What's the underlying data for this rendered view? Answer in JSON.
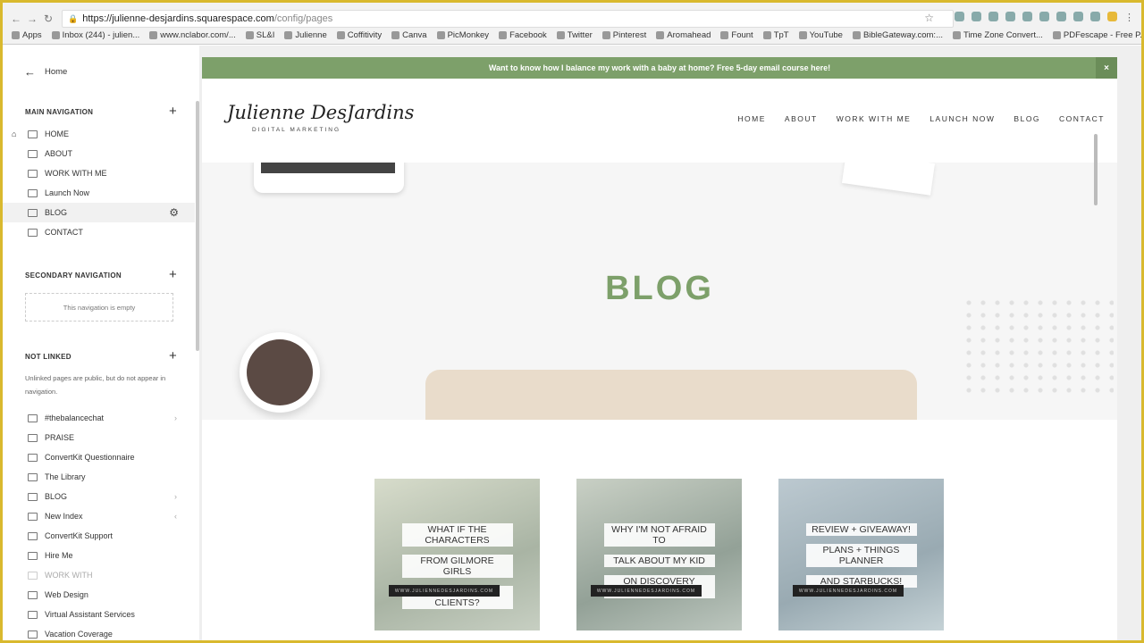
{
  "browser": {
    "url_host": "https://julienne-desjardins.squarespace.com",
    "url_path": "/config/pages",
    "bookmarks": [
      "Apps",
      "Inbox (244) - julien...",
      "www.nclabor.com/...",
      "SL&I",
      "Julienne",
      "Coffitivity",
      "Canva",
      "PicMonkey",
      "Facebook",
      "Twitter",
      "Pinterest",
      "Aromahead",
      "Fount",
      "TpT",
      "YouTube",
      "BibleGateway.com:...",
      "Time Zone Convert...",
      "PDFescape - Free P..."
    ]
  },
  "sidebar": {
    "back_label": "Home",
    "main_nav": {
      "title": "MAIN NAVIGATION",
      "items": [
        "HOME",
        "ABOUT",
        "WORK WITH ME",
        "Launch Now",
        "BLOG",
        "CONTACT"
      ]
    },
    "secondary_nav": {
      "title": "SECONDARY NAVIGATION",
      "empty_text": "This navigation is empty"
    },
    "not_linked": {
      "title": "NOT LINKED",
      "note": "Unlinked pages are public, but do not appear in navigation.",
      "items": [
        "#thebalancechat",
        "PRAISE",
        "ConvertKit Questionnaire",
        "The Library",
        "BLOG",
        "New Index",
        "ConvertKit Support",
        "Hire Me",
        "WORK WITH",
        "Web Design",
        "Virtual Assistant Services",
        "Vacation Coverage"
      ]
    }
  },
  "site": {
    "banner": "Want to know how I balance my work with a baby at home? Free 5-day email course here!",
    "banner_close": "×",
    "logo": "Julienne DesJardins",
    "logo_sub": "DIGITAL MARKETING",
    "nav": [
      "HOME",
      "ABOUT",
      "WORK WITH ME",
      "LAUNCH NOW",
      "BLOG",
      "CONTACT"
    ],
    "hero_title": "BLOG",
    "posts": [
      {
        "lines": [
          "WHAT IF THE CHARACTERS",
          "FROM GILMORE GIRLS",
          "WERE YOUR CLIENTS?"
        ],
        "url": "WWW.JULIENNEDESJARDINS.COM"
      },
      {
        "lines": [
          "WHY I'M NOT AFRAID TO",
          "TALK ABOUT MY KID",
          "ON DISCOVERY CALLS"
        ],
        "url": "WWW.JULIENNEDESJARDINS.COM"
      },
      {
        "lines": [
          "REVIEW + GIVEAWAY!",
          "PLANS + THINGS PLANNER",
          "AND STARBUCKS!"
        ],
        "url": "WWW.JULIENNEDESJARDINS.COM"
      }
    ]
  },
  "colors": {
    "accent": "#7da06a",
    "frame": "#d9b92e"
  }
}
